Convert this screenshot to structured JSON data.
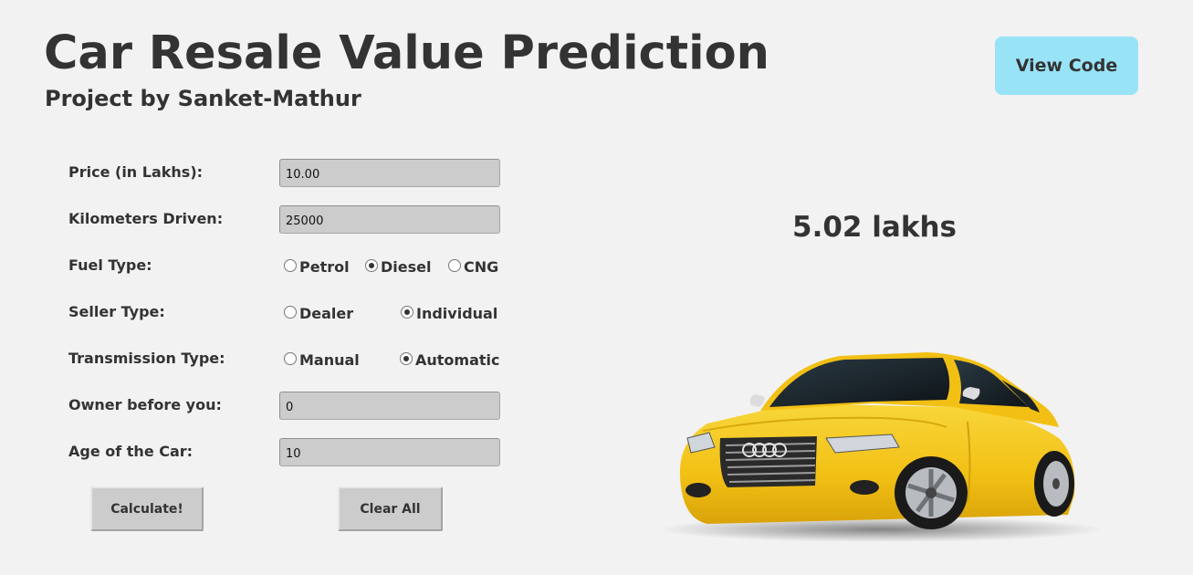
{
  "header": {
    "title": "Car Resale Value Prediction",
    "subtitle": "Project by Sanket-Mathur",
    "view_code_label": "View Code"
  },
  "form": {
    "price": {
      "label": "Price (in Lakhs):",
      "value": "10.00"
    },
    "kilometers": {
      "label": "Kilometers Driven:",
      "value": "25000"
    },
    "fuel": {
      "label": "Fuel Type:",
      "options": [
        "Petrol",
        "Diesel",
        "CNG"
      ],
      "selected": "Diesel"
    },
    "seller": {
      "label": "Seller Type:",
      "options": [
        "Dealer",
        "Individual"
      ],
      "selected": "Individual"
    },
    "transmission": {
      "label": "Transmission Type:",
      "options": [
        "Manual",
        "Automatic"
      ],
      "selected": "Automatic"
    },
    "owner": {
      "label": "Owner before you:",
      "value": "0"
    },
    "age": {
      "label": "Age of the Car:",
      "value": "10"
    },
    "calculate_label": "Calculate!",
    "clear_label": "Clear All"
  },
  "result": {
    "text": "5.02 lakhs"
  },
  "colors": {
    "background": "#f2f2f2",
    "text": "#333333",
    "view_code_button": "#99e3f7",
    "input_background": "#cccccc",
    "car_body": "#f3c318"
  },
  "icons": {
    "car": "yellow-sedan-car-image"
  }
}
